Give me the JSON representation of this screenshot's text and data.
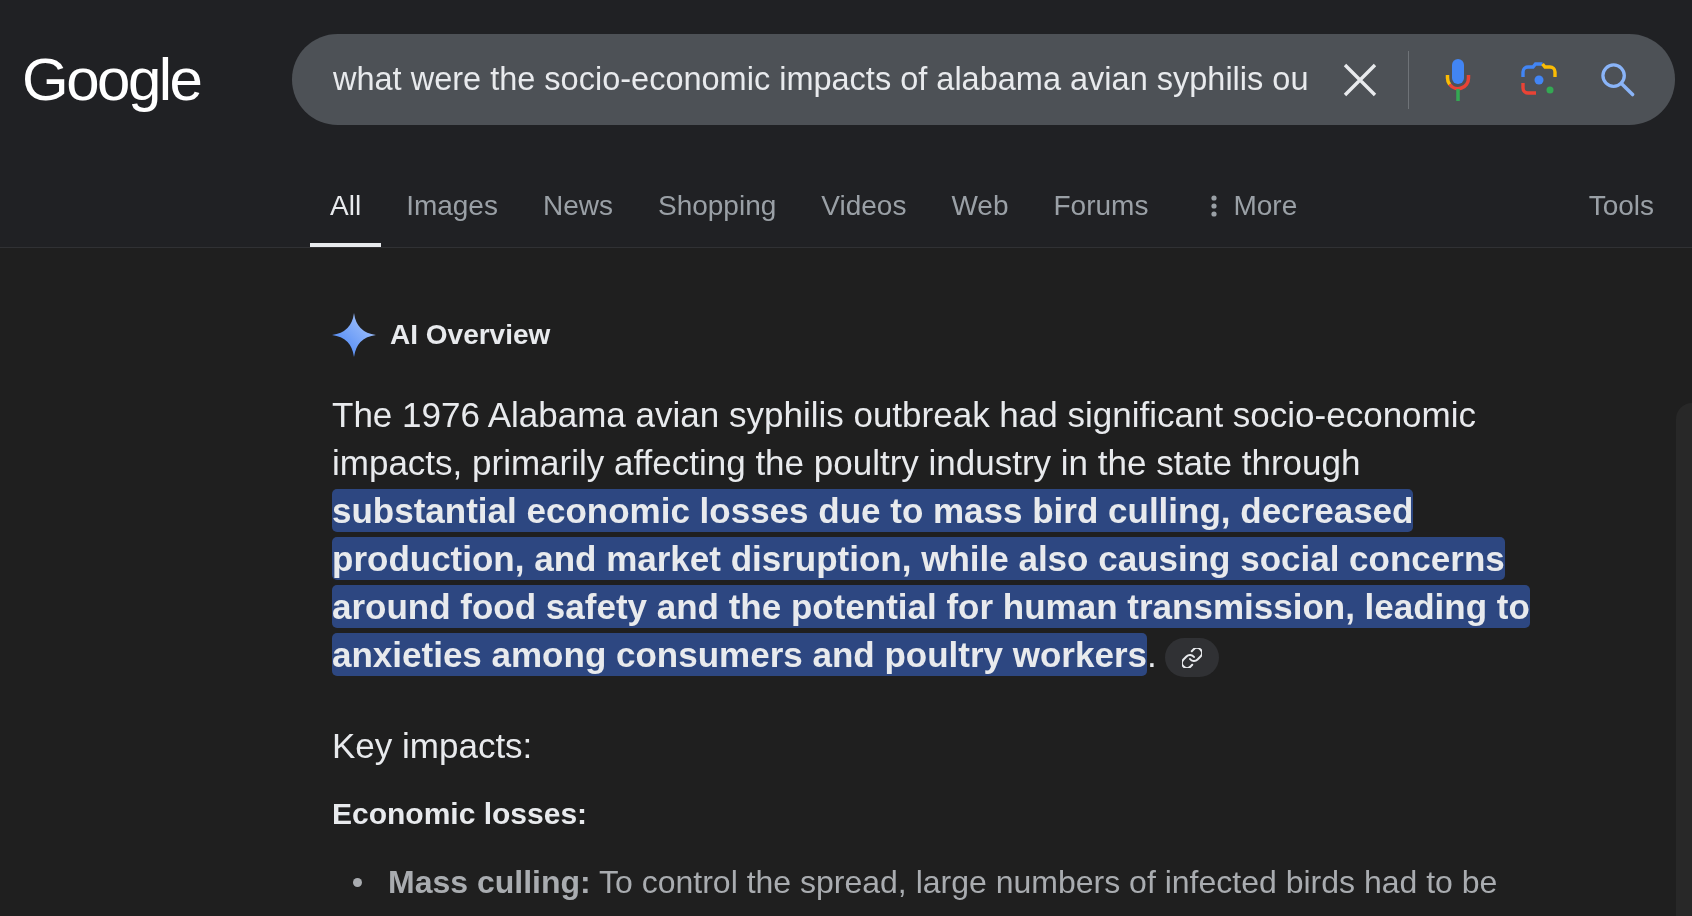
{
  "header": {
    "logo": "Google",
    "search": {
      "value": "what were the socio-economic impacts of alabama avian syphilis ou"
    }
  },
  "tabs": [
    {
      "label": "All",
      "selected": true,
      "kind": "tab"
    },
    {
      "label": "Images",
      "selected": false,
      "kind": "tab"
    },
    {
      "label": "News",
      "selected": false,
      "kind": "tab"
    },
    {
      "label": "Shopping",
      "selected": false,
      "kind": "tab"
    },
    {
      "label": "Videos",
      "selected": false,
      "kind": "tab"
    },
    {
      "label": "Web",
      "selected": false,
      "kind": "tab"
    },
    {
      "label": "Forums",
      "selected": false,
      "kind": "tab"
    },
    {
      "label": "More",
      "selected": false,
      "kind": "menu"
    }
  ],
  "tools": {
    "label": "Tools"
  },
  "ai_overview": {
    "title": "AI Overview",
    "summary": "The 1976 Alabama avian syphilis outbreak had significant socio-economic impacts, primarily affecting the poultry industry in the state through **substantial economic losses due to mass bird culling, decreased production, and market disruption, while also causing social concerns around food safety and the potential for human transmission, leading to anxieties among consumers and poultry workers**.",
    "heading": "Key impacts:",
    "sections": [
      {
        "title": "Economic losses:",
        "bullets": [
          "**Mass culling:** To control the spread, large numbers of infected birds had to be"
        ]
      }
    ]
  }
}
